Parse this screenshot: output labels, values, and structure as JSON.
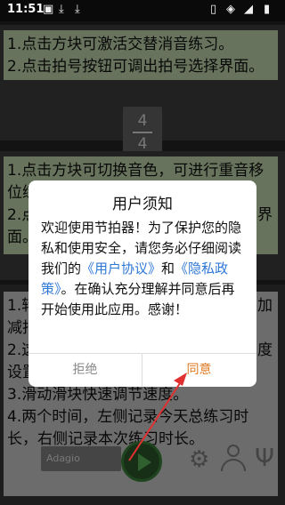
{
  "status_bar": {
    "time": "11:51",
    "icons": [
      "image-icon",
      "download-icon",
      "download-icon",
      "sim-icon",
      "wifi-icon",
      "signal-icon",
      "battery-icon"
    ]
  },
  "card1": {
    "lines": [
      "1.点击方块可激活交替消音练习。",
      "2.点击拍号按钮可调出拍号选择界面。"
    ],
    "time_signature": {
      "top": "4",
      "bottom": "4"
    }
  },
  "card2": {
    "lines": [
      "1.点击方块可切换音色，可进行重音移",
      "位练",
      "2.点",
      "界",
      "面。"
    ]
  },
  "card3": {
    "lines": [
      "1.转",
      "加",
      "减拍",
      "2.这",
      "度",
      "设置",
      "3.滑动滑块快速调节速度。",
      "4.两个时间，左侧记录今天总练习时",
      "长，右侧记录本次练习时长。"
    ],
    "tempo_label": "Adagio"
  },
  "dialog": {
    "title": "用户须知",
    "body_part1": "欢迎使用节拍器！为了保护您的隐私和使用安全，请您务必仔细阅读我们的",
    "user_agreement": "《用户协议》",
    "and": "和",
    "privacy_policy": "《隐私政策》",
    "body_part2": "。在确认充分理解并同意后再开始使用此应用。感谢！",
    "reject_label": "拒绝",
    "agree_label": "同意"
  },
  "colors": {
    "accent": "#e07a24",
    "link": "#2f78d6",
    "annotation_arrow": "#e03030",
    "text_band": "#cfe6b8"
  }
}
